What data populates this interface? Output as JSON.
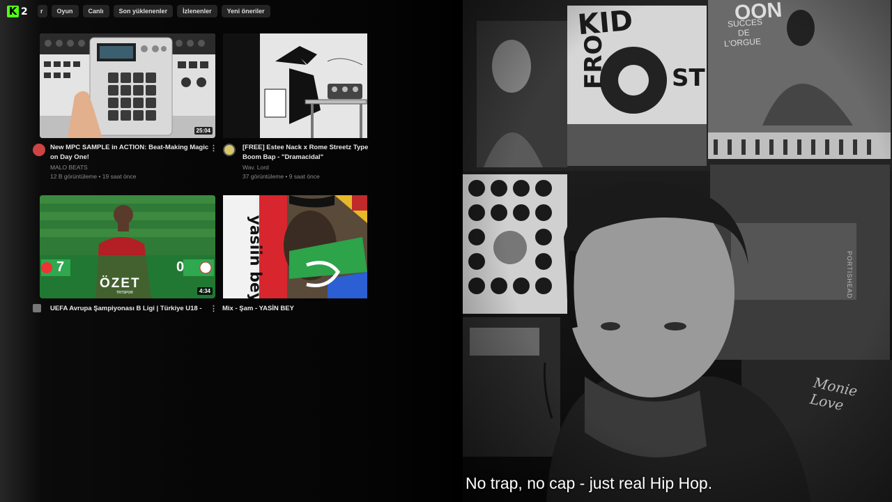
{
  "overlay": {
    "logo_letter": "K",
    "viewer_count": "2"
  },
  "chips": [
    "r",
    "Oyun",
    "Canlı",
    "Son yüklenenler",
    "İzlenenler",
    "Yeni öneriler"
  ],
  "videos": [
    {
      "title_line1": "New MPC SAMPLE in ACTION: Beat-Making Magic",
      "title_line2": "on Day One!",
      "channel": "MALO BEATS",
      "meta": "12 B görüntüleme • 19 saat önce",
      "duration": "25:04"
    },
    {
      "title_line1": "[FREE] Estee Nack x Rome Streetz Type B",
      "title_line2": "Boom Bap - \"Dramacidal\"",
      "channel": "Wav. Lord",
      "meta": "37 görüntüleme • 9 saat önce",
      "duration": ""
    },
    {
      "title_line1": "UEFA Avrupa Şampiyonası B Ligi | Türkiye U18 -",
      "title_line2": "",
      "channel": "",
      "meta": "",
      "duration": "4:34",
      "score_left": "7",
      "score_right": "0",
      "banner": "ÖZET",
      "brand": "TRTSPOR"
    },
    {
      "title_line1": "Mix - Şam - YASİN BEY",
      "title_line2": "",
      "channel": "",
      "meta": "",
      "duration": "",
      "art_text": "yasiin bey"
    }
  ],
  "menu_glyph": "⋮",
  "posters": {
    "kid_frost": [
      "KID",
      "FRO",
      "ST"
    ],
    "succes_lines": [
      "SUCCES",
      "DE",
      "L'ORGUE"
    ],
    "portishead": "PORTISHEAD",
    "wall_script": "Monie Love",
    "top_word": "OON"
  },
  "caption": "No trap, no cap - just real Hip Hop.",
  "colors": {
    "kick_green": "#53fc18",
    "chip_bg": "#242424",
    "pitch_green": "#2f7a36",
    "score_green": "#2fa84f"
  }
}
